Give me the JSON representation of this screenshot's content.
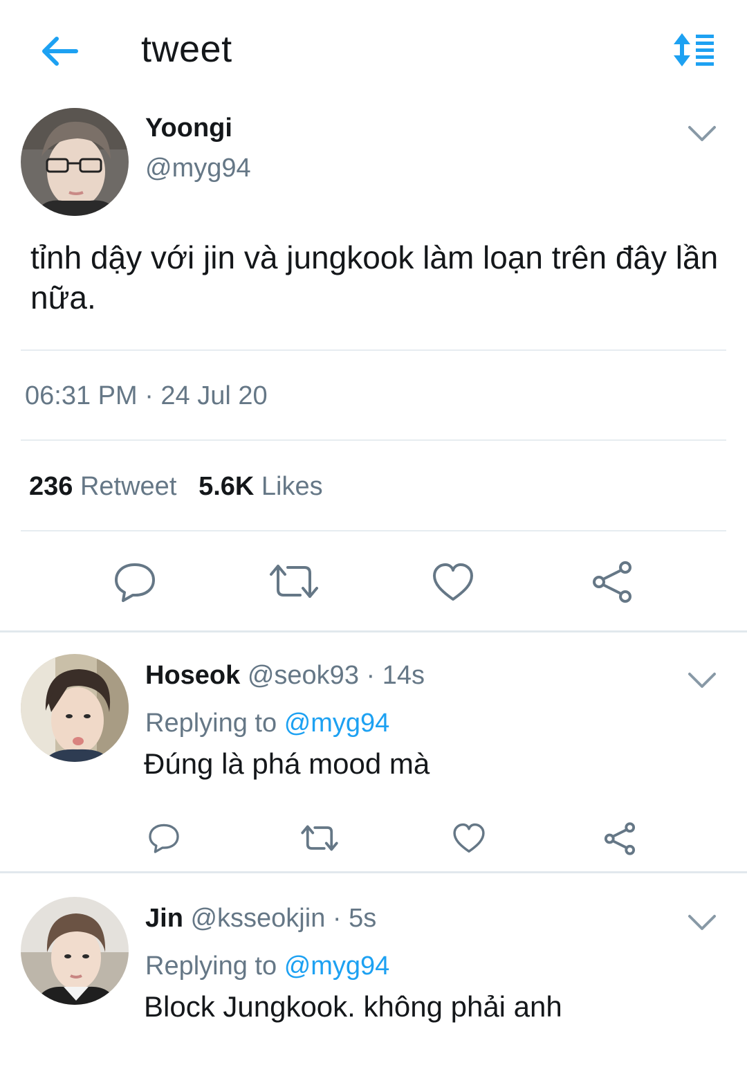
{
  "header": {
    "title": "tweet",
    "back_icon": "arrow-left-icon",
    "sort_icon": "sort-list-icon"
  },
  "colors": {
    "accent": "#1da1f2",
    "text": "#14171a",
    "muted": "#657786",
    "divider": "#e6ecf0"
  },
  "main_tweet": {
    "name": "Yoongi",
    "handle": "@myg94",
    "text": "tỉnh dậy với jin và jungkook làm loạn trên đây lần nữa.",
    "timestamp": "06:31 PM · 24 Jul 20",
    "retweets_count": "236",
    "retweets_label": "Retweet",
    "likes_count": "5.6K",
    "likes_label": "Likes"
  },
  "replies": [
    {
      "name": "Hoseok",
      "handle": "@seok93",
      "time": "· 14s",
      "replying_label": "Replying to",
      "replying_to": "@myg94",
      "text": "Đúng là phá mood mà"
    },
    {
      "name": "Jin",
      "handle": "@ksseokjin",
      "time": "· 5s",
      "replying_label": "Replying to",
      "replying_to": "@myg94",
      "text": "Block Jungkook. không phải anh"
    }
  ]
}
